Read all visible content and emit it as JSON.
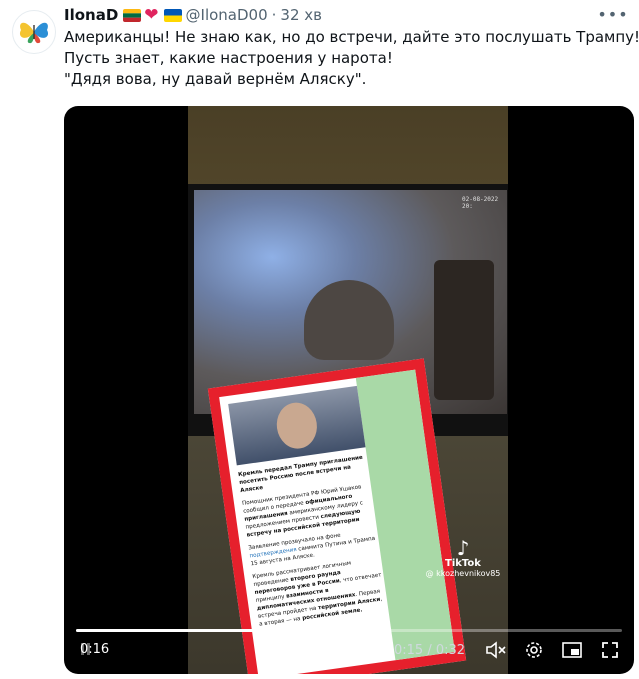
{
  "tweet": {
    "display_name": "IlonaD",
    "handle": "@IlonaD00",
    "separator": "·",
    "time": "32 хв",
    "lines": [
      "Американцы! Не знаю как, но до встречи, дайте это послушать Трампу!",
      "Пусть знает, какие настроения у нарота!",
      "\"Дядя вова, ну давай вернём Аляску\"."
    ],
    "flags": [
      "lithuania-flag",
      "red-heart",
      "ukraine-flag"
    ]
  },
  "video": {
    "tv_timestamp": "02-08-2022 20:",
    "card": {
      "headline": "Кремль передал Трампу приглашение посетить Россию после встречи на Аляске",
      "para1": "Помощник президента РФ Юрий Ушаков сообщил о передаче",
      "para1_bold": "официального приглашения",
      "para1b": "американскому лидеру с предложением провести",
      "para1_bold2": "следующую встречу на российской территории",
      "para2": "Заявление прозвучало на фоне",
      "para2_link": "подтверждения",
      "para2b": "саммита Путина и Трампа 15 августа на Аляске.",
      "para3": "Кремль рассматривает логичным проведение",
      "para3_bold": "второго раунда переговоров уже в России",
      "para3b": ", что отвечает принципу",
      "para3_bold2": "взаимности в дипломатических отношениях",
      "para3c": ". Первая встреча пройдет на",
      "para3_bold3": "территории Аляски",
      "para3d": ", а вторая — на",
      "para3_bold4": "российской земле."
    },
    "tiktok_label": "TikTok",
    "tiktok_user": "@ kkozhevnikov85",
    "elapsed_badge": "0:16",
    "play_time": "0:15 / 0:32",
    "progress": 0.47
  },
  "colors": {
    "accent": "#1d9bf0",
    "card_border": "#e6202c",
    "card_green": "#a9d9a7"
  },
  "icons": [
    "butterfly-avatar-icon",
    "more-icon",
    "volume-muted-icon",
    "settings-icon",
    "pip-icon",
    "fullscreen-icon",
    "tiktok-icon"
  ]
}
